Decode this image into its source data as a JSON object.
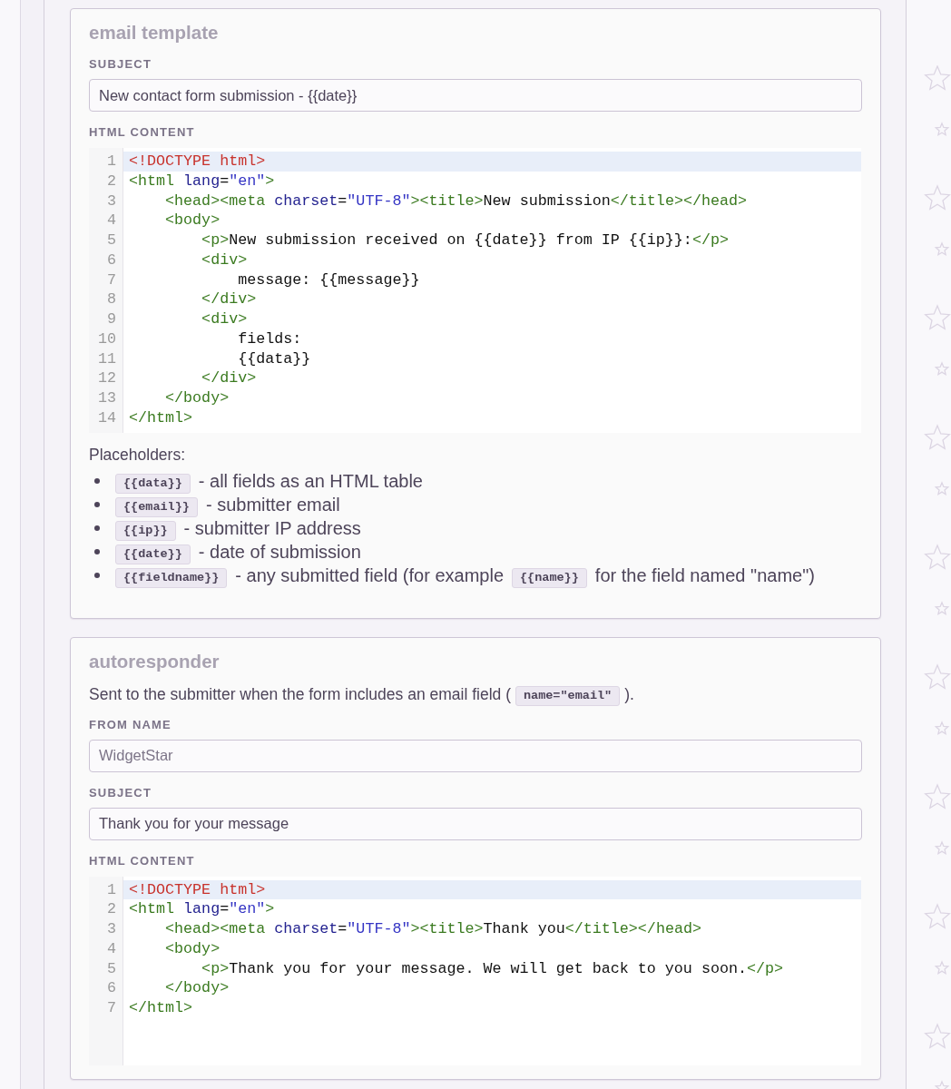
{
  "sections": [
    {
      "title": "email template",
      "fields": [
        {
          "kind": "input",
          "label": "SUBJECT",
          "value": "New contact form submission - {{date}}"
        },
        {
          "kind": "code",
          "label": "HTML CONTENT",
          "lines": [
            {
              "number": "1",
              "active": true,
              "tokens": [
                {
                  "kind": "doctype",
                  "text": "<!DOCTYPE html>"
                }
              ]
            },
            {
              "number": "2",
              "active": false,
              "tokens": [
                {
                  "kind": "tag",
                  "text": "<html"
                },
                {
                  "kind": "attr",
                  "text": " lang"
                },
                {
                  "kind": "text",
                  "text": "="
                },
                {
                  "kind": "string",
                  "text": "\"en\""
                },
                {
                  "kind": "tag",
                  "text": ">"
                }
              ]
            },
            {
              "number": "3",
              "active": false,
              "tokens": [
                {
                  "kind": "tag",
                  "text": "    <head><meta"
                },
                {
                  "kind": "attr",
                  "text": " charset"
                },
                {
                  "kind": "text",
                  "text": "="
                },
                {
                  "kind": "string",
                  "text": "\"UTF-8\""
                },
                {
                  "kind": "tag",
                  "text": "><title>"
                },
                {
                  "kind": "text",
                  "text": "New submission"
                },
                {
                  "kind": "tag",
                  "text": "</title></head>"
                }
              ]
            },
            {
              "number": "4",
              "active": false,
              "tokens": [
                {
                  "kind": "tag",
                  "text": "    <body>"
                }
              ]
            },
            {
              "number": "5",
              "active": false,
              "tokens": [
                {
                  "kind": "tag",
                  "text": "        <p>"
                },
                {
                  "kind": "text",
                  "text": "New submission received on {{date}} from IP {{ip}}:"
                },
                {
                  "kind": "tag",
                  "text": "</p>"
                }
              ]
            },
            {
              "number": "6",
              "active": false,
              "tokens": [
                {
                  "kind": "tag",
                  "text": "        <div>"
                }
              ]
            },
            {
              "number": "7",
              "active": false,
              "tokens": [
                {
                  "kind": "text",
                  "text": "            message: {{message}}"
                }
              ]
            },
            {
              "number": "8",
              "active": false,
              "tokens": [
                {
                  "kind": "tag",
                  "text": "        </div>"
                }
              ]
            },
            {
              "number": "9",
              "active": false,
              "tokens": [
                {
                  "kind": "tag",
                  "text": "        <div>"
                }
              ]
            },
            {
              "number": "10",
              "active": false,
              "tokens": [
                {
                  "kind": "text",
                  "text": "            fields:"
                }
              ]
            },
            {
              "number": "11",
              "active": false,
              "tokens": [
                {
                  "kind": "text",
                  "text": "            {{data}}"
                }
              ]
            },
            {
              "number": "12",
              "active": false,
              "tokens": [
                {
                  "kind": "tag",
                  "text": "        </div>"
                }
              ]
            },
            {
              "number": "13",
              "active": false,
              "tokens": [
                {
                  "kind": "tag",
                  "text": "    </body>"
                }
              ]
            },
            {
              "number": "14",
              "active": false,
              "tokens": [
                {
                  "kind": "tag",
                  "text": "</html>"
                }
              ]
            }
          ]
        }
      ],
      "placeholders": {
        "heading": "Placeholders:",
        "items": [
          {
            "parts": [
              {
                "kind": "code",
                "text": "{{data}}"
              },
              {
                "kind": "text",
                "text": "- all fields as an HTML table"
              }
            ]
          },
          {
            "parts": [
              {
                "kind": "code",
                "text": "{{email}}"
              },
              {
                "kind": "text",
                "text": "- submitter email"
              }
            ]
          },
          {
            "parts": [
              {
                "kind": "code",
                "text": "{{ip}}"
              },
              {
                "kind": "text",
                "text": "- submitter IP address"
              }
            ]
          },
          {
            "parts": [
              {
                "kind": "code",
                "text": "{{date}}"
              },
              {
                "kind": "text",
                "text": "- date of submission"
              }
            ]
          },
          {
            "parts": [
              {
                "kind": "code",
                "text": "{{fieldname}}"
              },
              {
                "kind": "text",
                "text": "- any submitted field (for example"
              },
              {
                "kind": "code",
                "text": "{{name}}"
              },
              {
                "kind": "text",
                "text": "for the field named \"name\")"
              }
            ]
          }
        ]
      }
    },
    {
      "title": "autoresponder",
      "description": [
        {
          "kind": "text",
          "text": "Sent to the submitter when the form includes an email field ("
        },
        {
          "kind": "code",
          "text": "name=\"email\""
        },
        {
          "kind": "text",
          "text": ")."
        }
      ],
      "fields": [
        {
          "kind": "input",
          "label": "FROM NAME",
          "placeholder": "WidgetStar"
        },
        {
          "kind": "input",
          "label": "SUBJECT",
          "value": "Thank you for your message"
        },
        {
          "kind": "code",
          "label": "HTML CONTENT",
          "lines": [
            {
              "number": "1",
              "active": true,
              "tokens": [
                {
                  "kind": "doctype",
                  "text": "<!DOCTYPE html>"
                }
              ]
            },
            {
              "number": "2",
              "active": false,
              "tokens": [
                {
                  "kind": "tag",
                  "text": "<html"
                },
                {
                  "kind": "attr",
                  "text": " lang"
                },
                {
                  "kind": "text",
                  "text": "="
                },
                {
                  "kind": "string",
                  "text": "\"en\""
                },
                {
                  "kind": "tag",
                  "text": ">"
                }
              ]
            },
            {
              "number": "3",
              "active": false,
              "tokens": [
                {
                  "kind": "tag",
                  "text": "    <head><meta"
                },
                {
                  "kind": "attr",
                  "text": " charset"
                },
                {
                  "kind": "text",
                  "text": "="
                },
                {
                  "kind": "string",
                  "text": "\"UTF-8\""
                },
                {
                  "kind": "tag",
                  "text": "><title>"
                },
                {
                  "kind": "text",
                  "text": "Thank you"
                },
                {
                  "kind": "tag",
                  "text": "</title></head>"
                }
              ]
            },
            {
              "number": "4",
              "active": false,
              "tokens": [
                {
                  "kind": "tag",
                  "text": "    <body>"
                }
              ]
            },
            {
              "number": "5",
              "active": false,
              "tokens": [
                {
                  "kind": "tag",
                  "text": "        <p>"
                },
                {
                  "kind": "text",
                  "text": "Thank you for your message. We will get back to you soon."
                },
                {
                  "kind": "tag",
                  "text": "</p>"
                }
              ]
            },
            {
              "number": "6",
              "active": false,
              "tokens": [
                {
                  "kind": "tag",
                  "text": "    </body>"
                }
              ]
            },
            {
              "number": "7",
              "active": false,
              "tokens": [
                {
                  "kind": "tag",
                  "text": "</html>"
                }
              ]
            }
          ]
        }
      ]
    }
  ]
}
